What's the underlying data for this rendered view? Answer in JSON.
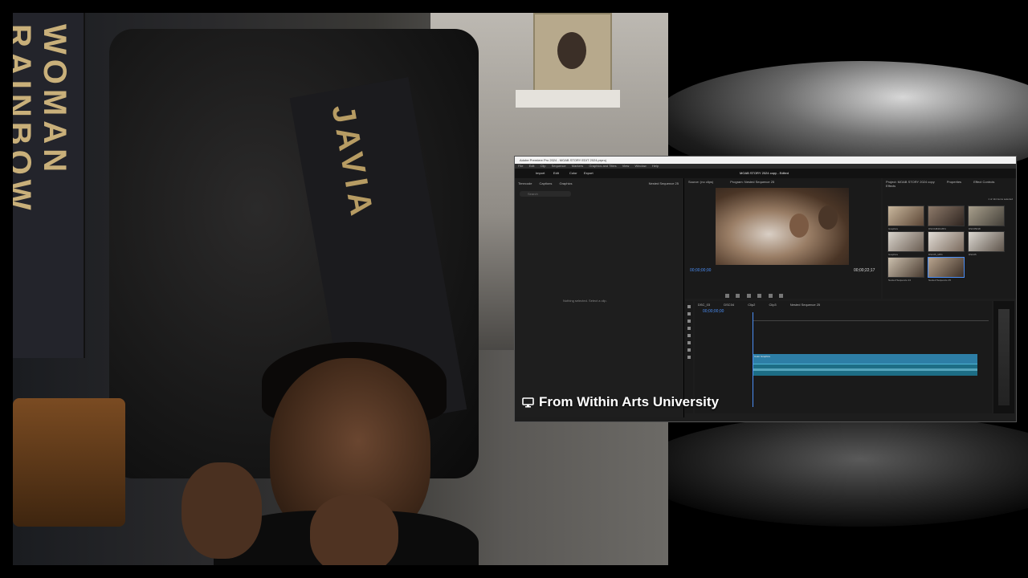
{
  "camera": {
    "banner_left_text": "WOMAN RAINBOW",
    "banner_right_text": "JAVIA"
  },
  "share": {
    "window_title": "Adobe Premiere Pro 2024 - MOAB STORY EDIT 2024.prproj",
    "menu": [
      "File",
      "Edit",
      "Clip",
      "Sequence",
      "Markers",
      "Graphics and Titles",
      "View",
      "Window",
      "Help"
    ],
    "workspaces": [
      "Import",
      "Edit",
      "Color",
      "Export"
    ],
    "project_title": "MOAB STORY 2024 copy - Edited",
    "graphics_tabs": [
      "Timecode",
      "Captions",
      "Graphics"
    ],
    "graphics_right": "Nested Sequence 25",
    "search_placeholder": "Search",
    "no_selection": "Nothing selected. Select a clip.",
    "monitor_tabs": [
      "Source: (no clips)",
      "Program: Nested Sequence 25"
    ],
    "timecode_in": "00;00;00;00",
    "timecode_out": "00;00;22;17",
    "project_tabs": [
      "Project: MOAB STORY 2024 copy",
      "Properties",
      "Effect Controls",
      "Effects"
    ],
    "project_count": "1 of 114 items selected",
    "thumbs": [
      "Graphics",
      "DSC04849.MP4",
      "DSC05018",
      "Graphics",
      "DSC05_MP4",
      "DSC05",
      "Nested Sequence 24",
      "Nested Sequence 25"
    ],
    "timeline_tabs": [
      "DSC_03",
      "DSC04",
      "Clip2",
      "Clip3",
      "Nested Sequence 25"
    ],
    "timeline_tc": "00;00;00;00",
    "clip_label": "Color Graphics"
  },
  "caption": {
    "icon": "screen-share-icon",
    "text": "From Within Arts University"
  }
}
